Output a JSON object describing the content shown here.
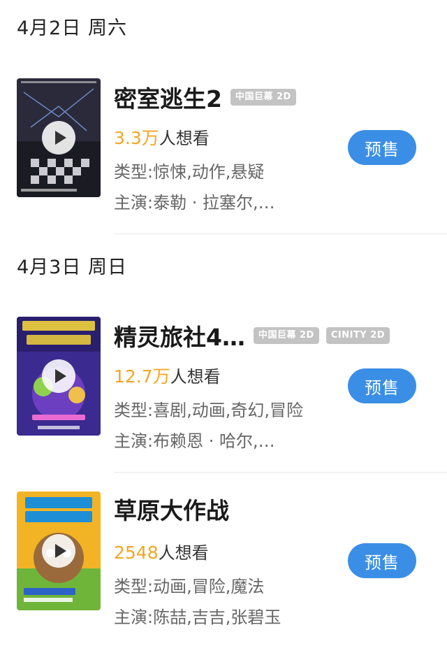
{
  "groups": [
    {
      "date": "4月2日 周六",
      "movie": {
        "title": "密室逃生2",
        "badges": [
          "中国巨幕 2D"
        ],
        "want_count": "3.3万",
        "want_suffix": "人想看",
        "genre": "类型:惊悚,动作,悬疑",
        "cast": "主演:泰勒 · 拉塞尔,…",
        "action": "预售",
        "poster_icon": "play-icon"
      }
    },
    {
      "date": "4月3日 周日",
      "movie": {
        "title": "精灵旅社4…",
        "badges": [
          "中国巨幕 2D",
          "CINITY 2D"
        ],
        "want_count": "12.7万",
        "want_suffix": "人想看",
        "genre": "类型:喜剧,动画,奇幻,冒险",
        "cast": "主演:布赖恩 · 哈尔,…",
        "action": "预售",
        "poster_icon": "play-icon"
      }
    },
    {
      "date": "",
      "movie": {
        "title": "草原大作战",
        "badges": [],
        "want_count": "2548",
        "want_suffix": "人想看",
        "genre": "类型:动画,冒险,魔法",
        "cast": "主演:陈喆,吉吉,张碧玉",
        "action": "预售",
        "poster_icon": "play-icon"
      }
    }
  ],
  "colors": {
    "accent": "#3a8ee6",
    "want_number": "#f5a623",
    "badge_bg": "#c3c3c3"
  }
}
